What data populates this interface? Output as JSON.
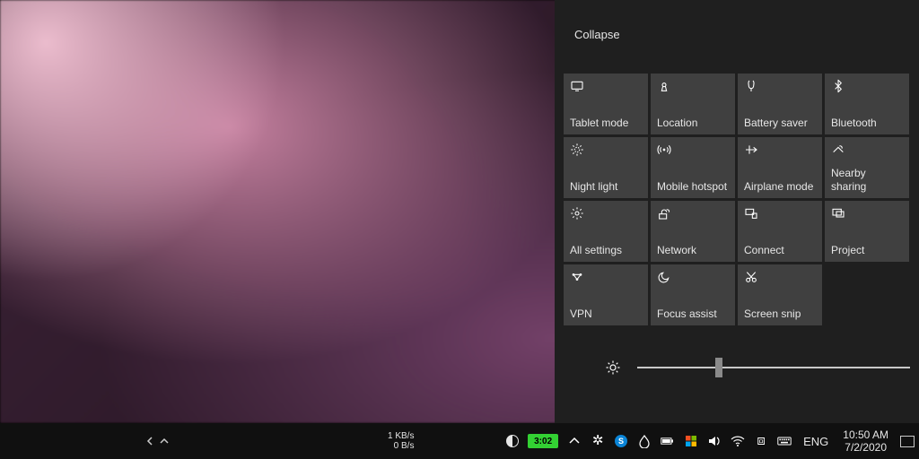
{
  "action_center": {
    "collapse_label": "Collapse",
    "tiles": [
      {
        "icon": "tablet-icon",
        "label": "Tablet mode"
      },
      {
        "icon": "location-icon",
        "label": "Location"
      },
      {
        "icon": "battery-icon",
        "label": "Battery saver"
      },
      {
        "icon": "bluetooth-icon",
        "label": "Bluetooth"
      },
      {
        "icon": "night-icon",
        "label": "Night light"
      },
      {
        "icon": "hotspot-icon",
        "label": "Mobile hotspot"
      },
      {
        "icon": "airplane-icon",
        "label": "Airplane mode"
      },
      {
        "icon": "nearby-icon",
        "label": "Nearby sharing"
      },
      {
        "icon": "settings-icon",
        "label": "All settings"
      },
      {
        "icon": "network-icon",
        "label": "Network"
      },
      {
        "icon": "connect-icon",
        "label": "Connect"
      },
      {
        "icon": "project-icon",
        "label": "Project"
      },
      {
        "icon": "vpn-icon",
        "label": "VPN"
      },
      {
        "icon": "focus-icon",
        "label": "Focus assist"
      },
      {
        "icon": "snip-icon",
        "label": "Screen snip"
      }
    ],
    "brightness_percent": 30
  },
  "taskbar": {
    "net_up": "1 KB/s",
    "net_down": "0 B/s",
    "battery_label": "3:02",
    "lang": "ENG",
    "time": "10:50 AM",
    "date": "7/2/2020"
  }
}
